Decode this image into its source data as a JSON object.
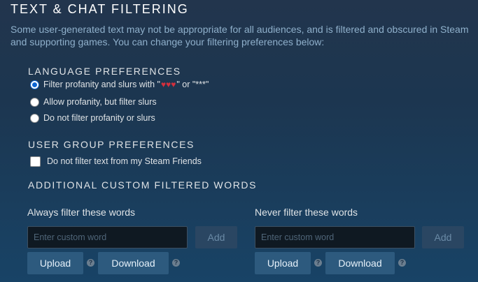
{
  "section": {
    "title": "TEXT & CHAT FILTERING",
    "description": "Some user-generated text may not be appropriate for all audiences, and is filtered and obscured in Steam and supporting games. You can change your filtering preferences below:"
  },
  "language": {
    "heading": "LANGUAGE PREFERENCES",
    "options": [
      {
        "label_before": "Filter profanity and slurs with \"",
        "hearts": "♥♥♥",
        "label_after": "\" or \"***\"",
        "checked": true
      },
      {
        "label": "Allow profanity, but filter slurs",
        "checked": false
      },
      {
        "label": "Do not filter profanity or slurs",
        "checked": false
      }
    ]
  },
  "user_group": {
    "heading": "USER GROUP PREFERENCES",
    "checkbox_label": "Do not filter text from my Steam Friends",
    "checked": false
  },
  "custom": {
    "heading": "ADDITIONAL CUSTOM FILTERED WORDS",
    "always": {
      "label": "Always filter these words",
      "placeholder": "Enter custom word",
      "add_label": "Add",
      "upload_label": "Upload",
      "download_label": "Download",
      "help_glyph": "?"
    },
    "never": {
      "label": "Never filter these words",
      "placeholder": "Enter custom word",
      "add_label": "Add",
      "upload_label": "Upload",
      "download_label": "Download",
      "help_glyph": "?"
    }
  },
  "colors": {
    "accent_radio": "#0b64d4",
    "hearts": "#d32f3c",
    "button_blue": "#2d5a7e",
    "button_disabled": "#2a4662"
  }
}
